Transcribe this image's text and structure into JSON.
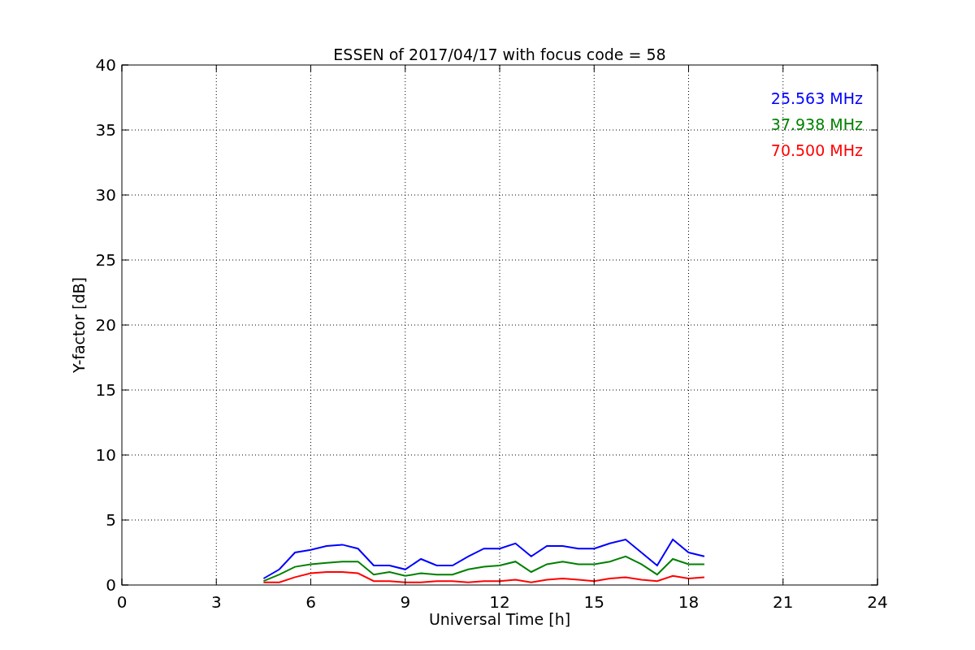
{
  "figure": {
    "chart_data": {
      "type": "line",
      "title": "ESSEN of 2017/04/17 with focus code = 58",
      "xlabel": "Universal Time [h]",
      "ylabel": "Y-factor [dB]",
      "x": [
        4.5,
        5,
        5.5,
        6,
        6.5,
        7,
        7.5,
        8,
        8.5,
        9,
        9.5,
        10,
        10.5,
        11,
        11.5,
        12,
        12.5,
        13,
        13.5,
        14,
        14.5,
        15,
        15.5,
        16,
        16.5,
        17,
        17.5,
        18,
        18.5
      ],
      "series": [
        {
          "name": "25.563 MHz",
          "color": "#0000ff",
          "values": [
            0.5,
            1.2,
            2.5,
            2.7,
            3,
            3.1,
            2.8,
            1.5,
            1.5,
            1.2,
            2,
            1.5,
            1.5,
            2.2,
            2.8,
            2.8,
            3.2,
            2.2,
            3,
            3,
            2.8,
            2.8,
            3.2,
            3.5,
            2.5,
            1.5,
            3.5,
            2.5,
            2.2
          ]
        },
        {
          "name": "37.938 MHz",
          "color": "#008000",
          "values": [
            0.3,
            0.8,
            1.4,
            1.6,
            1.7,
            1.8,
            1.8,
            0.8,
            1,
            0.7,
            0.9,
            0.8,
            0.8,
            1.2,
            1.4,
            1.5,
            1.8,
            1,
            1.6,
            1.8,
            1.6,
            1.6,
            1.8,
            2.2,
            1.6,
            0.8,
            2,
            1.6,
            1.6
          ]
        },
        {
          "name": "70.500 MHz",
          "color": "#ff0000",
          "values": [
            0.2,
            0.2,
            0.6,
            0.9,
            1,
            1,
            0.9,
            0.3,
            0.3,
            0.2,
            0.2,
            0.3,
            0.3,
            0.2,
            0.3,
            0.3,
            0.4,
            0.2,
            0.4,
            0.5,
            0.4,
            0.3,
            0.5,
            0.6,
            0.4,
            0.3,
            0.7,
            0.5,
            0.6
          ]
        }
      ],
      "grid": true,
      "xlim": [
        0,
        24
      ],
      "ylim": [
        0,
        40
      ],
      "xticks": [
        0,
        3,
        6,
        9,
        12,
        15,
        18,
        21,
        24
      ],
      "yticks": [
        0,
        5,
        10,
        15,
        20,
        25,
        30,
        35,
        40
      ]
    }
  }
}
